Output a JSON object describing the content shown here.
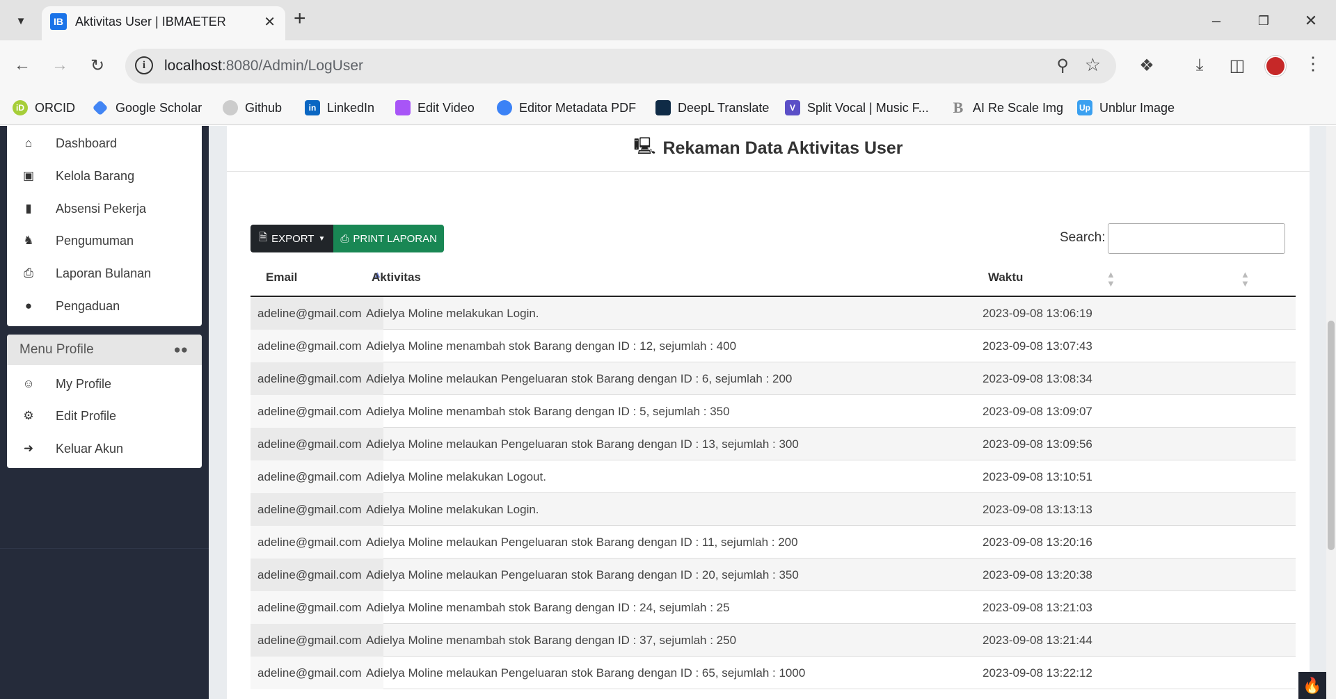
{
  "browser": {
    "tab_title": "Aktivitas User | IBMAETER",
    "tab_favicon": "IB",
    "url_host": "localhost",
    "url_path": ":8080/Admin/LogUser",
    "bookmarks": [
      {
        "label": "ORCID",
        "icon": "orcid-icon",
        "color": "#a6ce39"
      },
      {
        "label": "Google Scholar",
        "icon": "google-scholar-icon",
        "color": "#4285f4"
      },
      {
        "label": "Github",
        "icon": "github-icon",
        "color": "#cccccc"
      },
      {
        "label": "LinkedIn",
        "icon": "linkedin-icon",
        "color": "#0a66c2"
      },
      {
        "label": "Edit Video",
        "icon": "edit-video-icon",
        "color": "#a855f7"
      },
      {
        "label": "Editor Metadata PDF",
        "icon": "editor-metadata-icon",
        "color": "#3b82f6"
      },
      {
        "label": "DeepL Translate",
        "icon": "deepl-icon",
        "color": "#0f2b46"
      },
      {
        "label": "Split Vocal | Music F...",
        "icon": "split-vocal-icon",
        "color": "#5b4fc7"
      },
      {
        "label": "AI Re Scale Img",
        "icon": "ai-rescale-icon",
        "color": "#9ca3af"
      },
      {
        "label": "Unblur Image",
        "icon": "unblur-icon",
        "color": "#3aa0f0"
      }
    ]
  },
  "sidebar": {
    "menu_items": [
      {
        "label": "Dashboard",
        "icon": "home-icon"
      },
      {
        "label": "Kelola Barang",
        "icon": "box-icon"
      },
      {
        "label": "Absensi Pekerja",
        "icon": "clipboard-icon"
      },
      {
        "label": "Pengumuman",
        "icon": "bell-icon"
      },
      {
        "label": "Laporan Bulanan",
        "icon": "print-icon"
      },
      {
        "label": "Pengaduan",
        "icon": "chat-icon"
      }
    ],
    "profile_header": "Menu Profile",
    "profile_items": [
      {
        "label": "My Profile",
        "icon": "user-circle-icon"
      },
      {
        "label": "Edit Profile",
        "icon": "user-cog-icon"
      },
      {
        "label": "Keluar Akun",
        "icon": "sign-out-icon"
      }
    ]
  },
  "main": {
    "title": "Rekaman Data Aktivitas User",
    "export_label": "EXPORT",
    "print_label": "PRINT LAPORAN",
    "search_label": "Search:",
    "search_value": "",
    "columns": [
      "Email",
      "Aktivitas",
      "Waktu"
    ],
    "sort_column": "Email",
    "rows": [
      {
        "email": "adeline@gmail.com",
        "aktivitas": "Adielya Moline melakukan Login.",
        "waktu": "2023-09-08 13:06:19"
      },
      {
        "email": "adeline@gmail.com",
        "aktivitas": "Adielya Moline menambah stok Barang dengan ID : 12, sejumlah : 400",
        "waktu": "2023-09-08 13:07:43"
      },
      {
        "email": "adeline@gmail.com",
        "aktivitas": "Adielya Moline melaukan Pengeluaran stok Barang dengan ID : 6, sejumlah : 200",
        "waktu": "2023-09-08 13:08:34"
      },
      {
        "email": "adeline@gmail.com",
        "aktivitas": "Adielya Moline menambah stok Barang dengan ID : 5, sejumlah : 350",
        "waktu": "2023-09-08 13:09:07"
      },
      {
        "email": "adeline@gmail.com",
        "aktivitas": "Adielya Moline melaukan Pengeluaran stok Barang dengan ID : 13, sejumlah : 300",
        "waktu": "2023-09-08 13:09:56"
      },
      {
        "email": "adeline@gmail.com",
        "aktivitas": "Adielya Moline melakukan Logout.",
        "waktu": "2023-09-08 13:10:51"
      },
      {
        "email": "adeline@gmail.com",
        "aktivitas": "Adielya Moline melakukan Login.",
        "waktu": "2023-09-08 13:13:13"
      },
      {
        "email": "adeline@gmail.com",
        "aktivitas": "Adielya Moline melaukan Pengeluaran stok Barang dengan ID : 11, sejumlah : 200",
        "waktu": "2023-09-08 13:20:16"
      },
      {
        "email": "adeline@gmail.com",
        "aktivitas": "Adielya Moline melaukan Pengeluaran stok Barang dengan ID : 20, sejumlah : 350",
        "waktu": "2023-09-08 13:20:38"
      },
      {
        "email": "adeline@gmail.com",
        "aktivitas": "Adielya Moline menambah stok Barang dengan ID : 24, sejumlah : 25",
        "waktu": "2023-09-08 13:21:03"
      },
      {
        "email": "adeline@gmail.com",
        "aktivitas": "Adielya Moline menambah stok Barang dengan ID : 37, sejumlah : 250",
        "waktu": "2023-09-08 13:21:44"
      },
      {
        "email": "adeline@gmail.com",
        "aktivitas": "Adielya Moline melaukan Pengeluaran stok Barang dengan ID : 65, sejumlah : 1000",
        "waktu": "2023-09-08 13:22:12"
      }
    ]
  }
}
